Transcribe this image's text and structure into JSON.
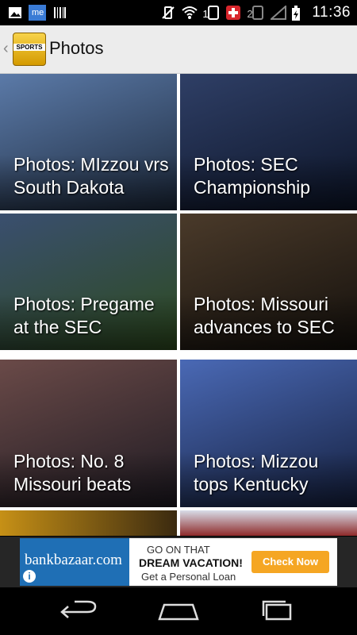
{
  "status_bar": {
    "time": "11:36",
    "left_icons": [
      "image-icon",
      "spider-me-icon",
      "barcode-icon"
    ],
    "spider_me_label": "me",
    "right_icons": [
      "vibrate-icon",
      "wifi-icon",
      "sim-1-icon",
      "swiss-cross-icon",
      "sim-2-icon",
      "signal-icon",
      "battery-icon"
    ],
    "sim1_label": "1",
    "sim2_label": "2"
  },
  "action_bar": {
    "title": "Photos",
    "logo_text": "SPORTS"
  },
  "tiles": [
    {
      "caption": "Photos: MIzzou vrs South Dakota",
      "colors": [
        "#5b7aa8",
        "#1d2a3d"
      ]
    },
    {
      "caption": "Photos: SEC Championship",
      "colors": [
        "#2f3f66",
        "#0c1428"
      ]
    },
    {
      "caption": "Photos: Pregame at the SEC",
      "colors": [
        "#3a4f6f",
        "#2d4a1e"
      ]
    },
    {
      "caption": "Photos: Missouri advances to SEC",
      "colors": [
        "#4a3a2a",
        "#14100c"
      ]
    },
    {
      "caption": "Photos: No. 8 Missouri beats",
      "colors": [
        "#6a4a48",
        "#1e1a22"
      ]
    },
    {
      "caption": "Photos: Mizzou tops Kentucky",
      "colors": [
        "#4a69b5",
        "#15203f"
      ]
    }
  ],
  "ad": {
    "brand": "bankbazaar.com",
    "line1": "GO ON THAT",
    "line2": "DREAM VACATION!",
    "line3": "Get a Personal Loan",
    "cta": "Check Now",
    "info": "i"
  },
  "nav_bar": {
    "buttons": [
      "back-icon",
      "home-icon",
      "recent-apps-icon"
    ]
  }
}
